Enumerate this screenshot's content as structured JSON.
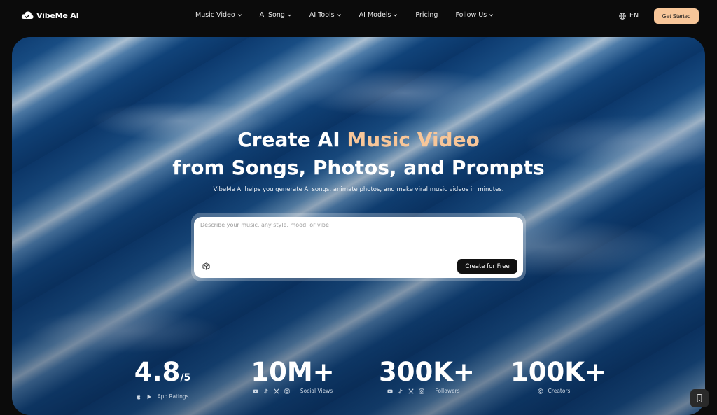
{
  "brand": {
    "name": "VibeMe AI"
  },
  "nav": {
    "items": [
      {
        "label": "Music Video",
        "dropdown": true
      },
      {
        "label": "AI Song",
        "dropdown": true
      },
      {
        "label": "AI Tools",
        "dropdown": true
      },
      {
        "label": "AI Models",
        "dropdown": true
      },
      {
        "label": "Pricing",
        "dropdown": false
      },
      {
        "label": "Follow Us",
        "dropdown": true
      }
    ],
    "language": "EN",
    "cta": "Get Started"
  },
  "hero": {
    "title_line1_pre": "Create AI ",
    "title_line1_accent": "Music Video",
    "title_line2": "from Songs, Photos, and Prompts",
    "subtitle": "VibeMe AI helps you generate AI songs, animate photos, and make viral music videos in minutes.",
    "prompt_placeholder": "Describe your music, any style, mood, or vibe",
    "prompt_value": "",
    "create_button": "Create for Free"
  },
  "stats": [
    {
      "value": "4.8",
      "suffix": "/5",
      "label": "App Ratings",
      "icons": [
        "apple-icon",
        "google-play-icon"
      ]
    },
    {
      "value": "10M+",
      "suffix": "",
      "label": "Social Views",
      "icons": [
        "youtube-icon",
        "tiktok-icon",
        "x-icon",
        "instagram-icon"
      ]
    },
    {
      "value": "300K+",
      "suffix": "",
      "label": "Followers",
      "icons": [
        "youtube-icon",
        "tiktok-icon",
        "x-icon",
        "instagram-icon"
      ]
    },
    {
      "value": "100K+",
      "suffix": "",
      "label": "Creators",
      "icons": [
        "creators-icon"
      ]
    }
  ],
  "colors": {
    "accent": "#f7c699",
    "background": "#0b0b0b",
    "hero_blue": "#103f73",
    "button_dark": "#111111"
  }
}
